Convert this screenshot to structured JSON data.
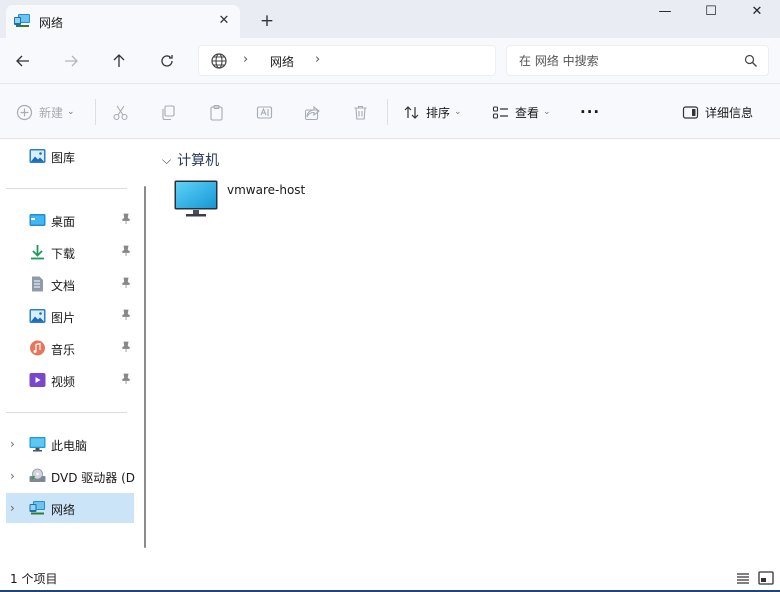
{
  "tab": {
    "title": "网络"
  },
  "window_controls": {
    "minimize": "—",
    "maximize": "☐",
    "close": "✕"
  },
  "address": {
    "location": "网络"
  },
  "search": {
    "placeholder": "在 网络 中搜索"
  },
  "commands": {
    "new": "新建",
    "sort": "排序",
    "view": "查看",
    "more": "···",
    "details": "详细信息"
  },
  "sidebar": {
    "top": [
      {
        "label": "图库"
      }
    ],
    "quick_access": [
      {
        "label": "桌面"
      },
      {
        "label": "下载"
      },
      {
        "label": "文档"
      },
      {
        "label": "图片"
      },
      {
        "label": "音乐"
      },
      {
        "label": "视频"
      }
    ],
    "locations": [
      {
        "label": "此电脑"
      },
      {
        "label": "DVD 驱动器 (D"
      },
      {
        "label": "网络"
      }
    ]
  },
  "content": {
    "group_title": "计算机",
    "items": [
      {
        "name": "vmware-host"
      }
    ]
  },
  "status": {
    "count_text": "1 个项目"
  },
  "colors": {
    "selected": "#cce4f7",
    "accent": "#0067c0",
    "monitor": "#1da1d8"
  }
}
